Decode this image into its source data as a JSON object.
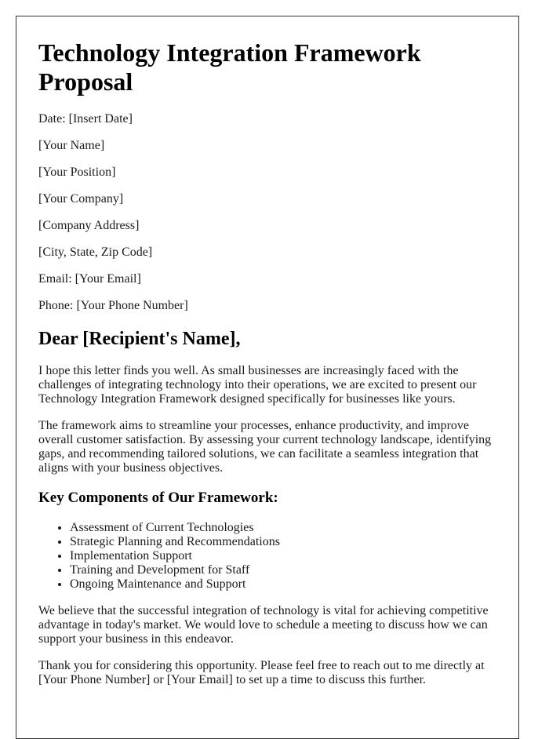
{
  "document": {
    "title": "Technology Integration Framework Proposal",
    "header_lines": [
      "Date: [Insert Date]",
      "[Your Name]",
      "[Your Position]",
      "[Your Company]",
      "[Company Address]",
      "[City, State, Zip Code]",
      "Email: [Your Email]",
      "Phone: [Your Phone Number]"
    ],
    "salutation": "Dear [Recipient's Name],",
    "paragraphs": {
      "intro": "I hope this letter finds you well. As small businesses are increasingly faced with the challenges of integrating technology into their operations, we are excited to present our Technology Integration Framework designed specifically for businesses like yours.",
      "aims": "The framework aims to streamline your processes, enhance productivity, and improve overall customer satisfaction. By assessing your current technology landscape, identifying gaps, and recommending tailored solutions, we can facilitate a seamless integration that aligns with your business objectives.",
      "belief": "We believe that the successful integration of technology is vital for achieving competitive advantage in today's market. We would love to schedule a meeting to discuss how we can support your business in this endeavor.",
      "closing": "Thank you for considering this opportunity. Please feel free to reach out to me directly at [Your Phone Number] or [Your Email] to set up a time to discuss this further."
    },
    "components_heading": "Key Components of Our Framework:",
    "components": [
      "Assessment of Current Technologies",
      "Strategic Planning and Recommendations",
      "Implementation Support",
      "Training and Development for Staff",
      "Ongoing Maintenance and Support"
    ]
  }
}
